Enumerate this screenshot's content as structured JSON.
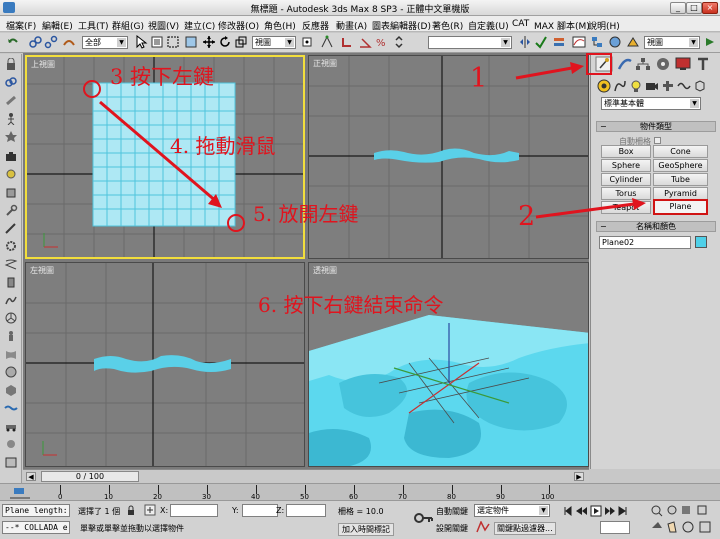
{
  "window": {
    "title": "無標題 - Autodesk 3ds Max 8 SP3 - 正體中文單機版",
    "min": "_",
    "max": "□",
    "close": "×"
  },
  "menu": [
    "檔案(F)",
    "編輯(E)",
    "工具(T)",
    "群組(G)",
    "視圖(V)",
    "建立(C)",
    "修改器(O)",
    "角色(H)",
    "反應器",
    "動畫(A)",
    "圖表編輯器(D)",
    "著色(R)",
    "自定義(U)",
    "CAT",
    "MAX 腳本(M)",
    "說明(H)"
  ],
  "toolbar": {
    "selection_filter": "全部",
    "ref_coord": "視圖",
    "named_sel": "",
    "viewport_menu": "視圖"
  },
  "viewports": {
    "top": "上視圖",
    "front": "正視圖",
    "left": "左視圖",
    "persp": "透視圖"
  },
  "command_panel": {
    "category_dropdown": "標準基本體",
    "rollout_object_type": "物件類型",
    "autogrid": "自動柵格",
    "buttons": [
      "Box",
      "Cone",
      "Sphere",
      "GeoSphere",
      "Cylinder",
      "Tube",
      "Torus",
      "Pyramid",
      "Teapot",
      "Plane"
    ],
    "rollout_name_color": "名稱和顏色",
    "object_name": "Plane02",
    "object_color": "#4fd0e8"
  },
  "timeline": {
    "frame_display": "0 / 100",
    "ticks": [
      "0",
      "10",
      "20",
      "30",
      "40",
      "50",
      "60",
      "70",
      "80",
      "90",
      "100"
    ]
  },
  "status": {
    "maxscript": "--* COLLADA e",
    "plane_length": "Plane length:",
    "selected": "選擇了 1 個",
    "x_label": "X:",
    "y_label": "Y:",
    "z_label": "Z:",
    "grid": "柵格 = 10.0",
    "prompt": "單擊或單擊並拖動以選擇物件",
    "add_time_tag": "加入時間標記",
    "auto_key": "自動關鍵",
    "set_key": "設開關鍵",
    "selected_obj": "選定物件",
    "key_filters": "關鍵點過濾器..."
  },
  "annotations": {
    "a1": "1",
    "a2": "2",
    "a3": "3 按下左鍵",
    "a4": "4. 拖動滑鼠",
    "a5": "5. 放開左鍵",
    "a6": "6. 按下右鍵結束命令"
  },
  "colors": {
    "annotation": "#e0141e",
    "active_viewport": "#f2de3c",
    "plane_cyan": "#56d6ec"
  }
}
